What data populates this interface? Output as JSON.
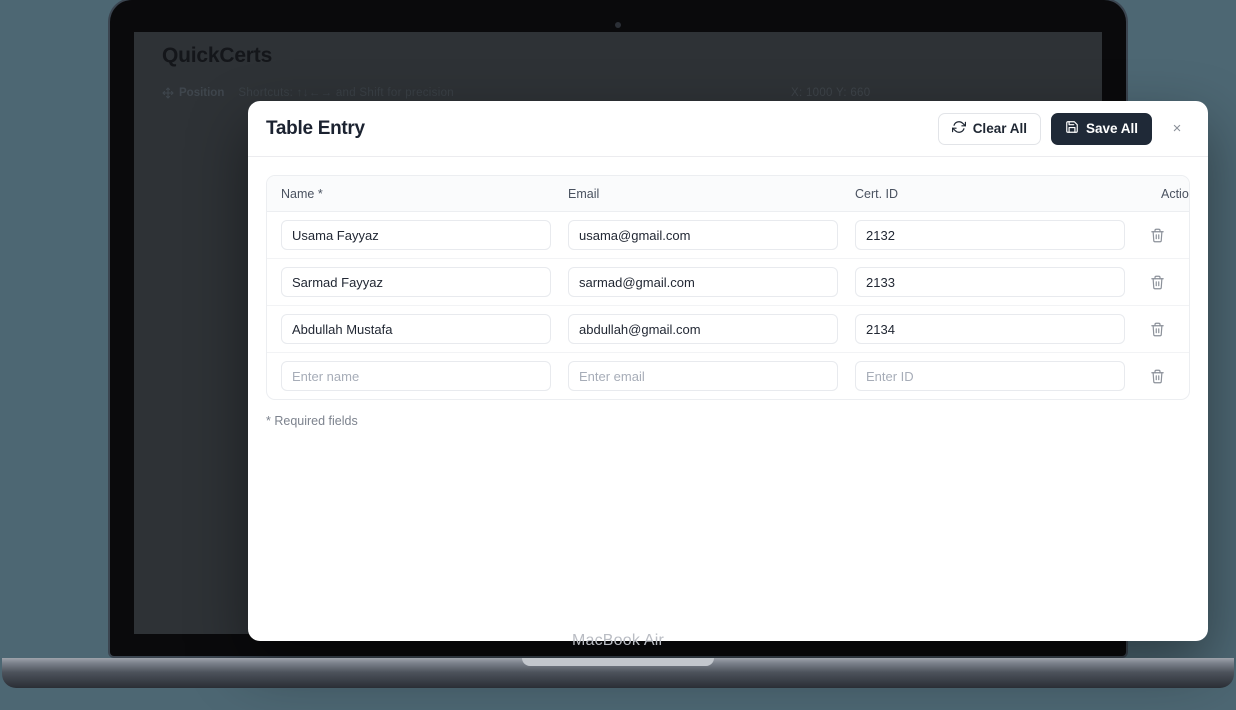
{
  "device": {
    "bezel_label": "MacBook Air",
    "camera_icon": "camera-dot"
  },
  "background_app": {
    "title": "QuickCerts",
    "toolbar": {
      "position_label": "Position",
      "position_icon": "move-arrows-icon",
      "shortcuts_text": "Shortcuts:  ↑↓←→  and  Shift  for precision",
      "coordinates": "X: 1000  Y: 660"
    }
  },
  "modal": {
    "title": "Table Entry",
    "clear_all_label": "Clear All",
    "clear_all_icon": "refresh-icon",
    "save_all_label": "Save All",
    "save_all_icon": "save-disk-icon",
    "close_icon": "close-icon",
    "close_label": "×",
    "required_note": "* Required fields",
    "table": {
      "columns": [
        "Name *",
        "Email",
        "Cert. ID",
        "Actions"
      ],
      "delete_icon": "trash-icon",
      "placeholders": {
        "name": "Enter name",
        "email": "Enter email",
        "cert_id": "Enter ID"
      },
      "rows": [
        {
          "name": "Usama Fayyaz",
          "email": "usama@gmail.com",
          "cert_id": "2132"
        },
        {
          "name": "Sarmad Fayyaz",
          "email": "sarmad@gmail.com",
          "cert_id": "2133"
        },
        {
          "name": "Abdullah Mustafa",
          "email": "abdullah@gmail.com",
          "cert_id": "2134"
        },
        {
          "name": "",
          "email": "",
          "cert_id": ""
        }
      ]
    }
  },
  "colors": {
    "page_background": "#4d6773",
    "modal_background": "#ffffff",
    "save_button": "#1f2937",
    "app_backdrop": "#2e3236"
  }
}
